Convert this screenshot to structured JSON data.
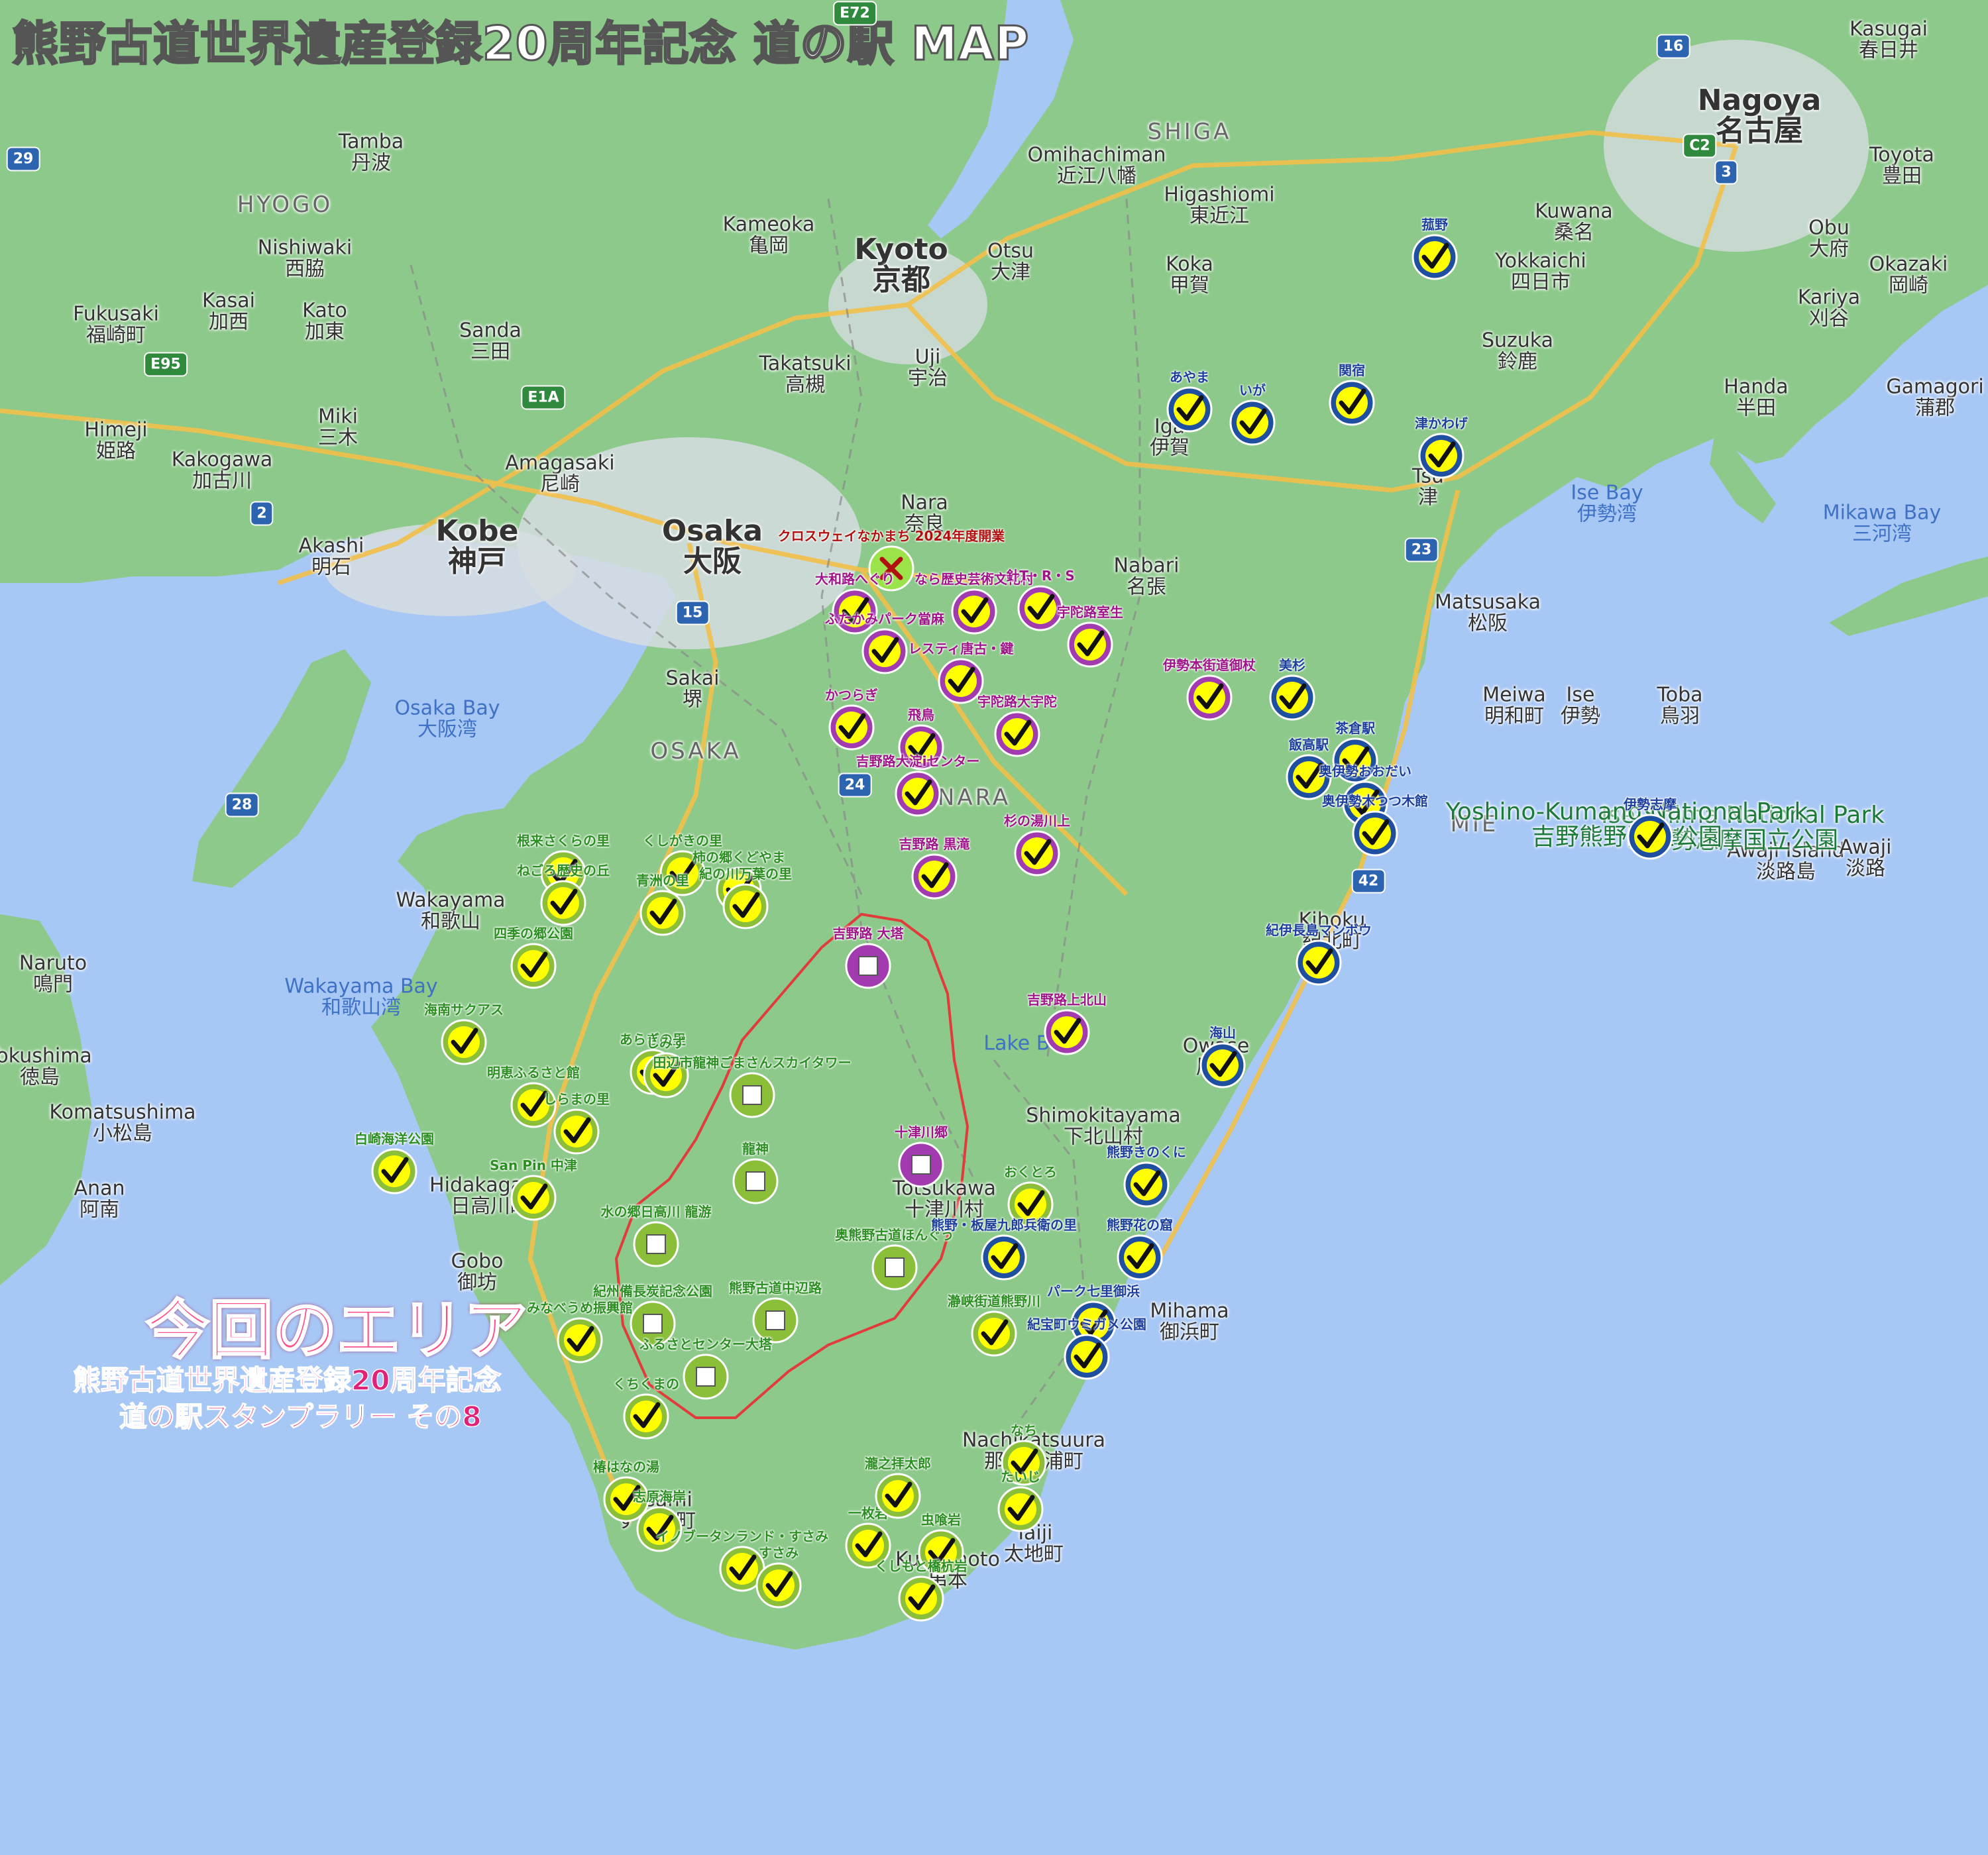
{
  "title": "熊野古道世界遺産登録20周年記念 道の駅 MAP",
  "area_title": "今回のエリア",
  "area_subtitle_1": "熊野古道世界遺産登録20周年記念",
  "area_subtitle_2": "道の駅スタンプラリー その8",
  "colors": {
    "land": "#8cc98a",
    "water": "#a7c7f5",
    "route": "#f2c04a",
    "area_outline": "#e23b3b",
    "marker_green": "#8bbf3a",
    "marker_purple": "#a23bb0",
    "marker_blue": "#1e4fa0",
    "check": "#ffff00"
  },
  "places": [
    {
      "name": "Nagoya 名古屋",
      "cls": "city"
    },
    {
      "name": "Kyoto 京都",
      "cls": "city"
    },
    {
      "name": "Osaka 大阪",
      "cls": "city"
    },
    {
      "name": "Kobe 神戸",
      "cls": "city"
    },
    {
      "name": "Himeji 姫路",
      "cls": "town"
    },
    {
      "name": "Wakayama 和歌山",
      "cls": "town"
    },
    {
      "name": "Nara 奈良",
      "cls": "town"
    },
    {
      "name": "Sakai 堺",
      "cls": "town"
    },
    {
      "name": "Otsu 大津",
      "cls": "town"
    },
    {
      "name": "Takatsuki 高槻",
      "cls": "town"
    },
    {
      "name": "Amagasaki 尼崎",
      "cls": "town"
    },
    {
      "name": "Akashi 明石",
      "cls": "town"
    },
    {
      "name": "Kameoka 亀岡",
      "cls": "town"
    },
    {
      "name": "Uji 宇治",
      "cls": "town"
    },
    {
      "name": "Kakogawa 加古川",
      "cls": "town"
    },
    {
      "name": "Miki 三木",
      "cls": "town"
    },
    {
      "name": "Sanda 三田",
      "cls": "town"
    },
    {
      "name": "Kato 加東",
      "cls": "town"
    },
    {
      "name": "Nishiwaki 西脇",
      "cls": "town"
    },
    {
      "name": "Tamba 丹波",
      "cls": "town"
    },
    {
      "name": "Kasai 加西",
      "cls": "town"
    },
    {
      "name": "Fukusaki 福崎町",
      "cls": "town"
    },
    {
      "name": "Omihachiman 近江八幡",
      "cls": "town"
    },
    {
      "name": "Higashiomi 東近江",
      "cls": "town"
    },
    {
      "name": "Koka 甲賀",
      "cls": "town"
    },
    {
      "name": "Iga 伊賀",
      "cls": "town"
    },
    {
      "name": "Nabari 名張",
      "cls": "town"
    },
    {
      "name": "Kuwana 桑名",
      "cls": "town"
    },
    {
      "name": "Yokkaichi 四日市",
      "cls": "town"
    },
    {
      "name": "Suzuka 鈴鹿",
      "cls": "town"
    },
    {
      "name": "Tsu 津",
      "cls": "town"
    },
    {
      "name": "Matsusaka 松阪",
      "cls": "town"
    },
    {
      "name": "Meiwa 明和町",
      "cls": "town"
    },
    {
      "name": "Ise 伊勢",
      "cls": "town"
    },
    {
      "name": "Toba 鳥羽",
      "cls": "town"
    },
    {
      "name": "Toyota 豊田",
      "cls": "town"
    },
    {
      "name": "Okazaki 岡崎",
      "cls": "town"
    },
    {
      "name": "Kariya 刈谷",
      "cls": "town"
    },
    {
      "name": "Handa 半田",
      "cls": "town"
    },
    {
      "name": "Obu 大府",
      "cls": "town"
    },
    {
      "name": "Kasugai 春日井",
      "cls": "town"
    },
    {
      "name": "Gamagori 蒲郡",
      "cls": "town"
    },
    {
      "name": "Naruto 鳴門",
      "cls": "town"
    },
    {
      "name": "Tokushima 徳島",
      "cls": "town"
    },
    {
      "name": "Komatsushima 小松島",
      "cls": "town"
    },
    {
      "name": "Anan 阿南",
      "cls": "town"
    },
    {
      "name": "Hidakagawa 日高川町",
      "cls": "town"
    },
    {
      "name": "Gobo 御坊",
      "cls": "town"
    },
    {
      "name": "Susami すさみ町",
      "cls": "town"
    },
    {
      "name": "Kushimoto 串本",
      "cls": "town"
    },
    {
      "name": "Nachikatsuura 那智勝浦町",
      "cls": "town"
    },
    {
      "name": "Taiji 太地町",
      "cls": "town"
    },
    {
      "name": "Totsukawa 十津川村",
      "cls": "town"
    },
    {
      "name": "Shimokitayama 下北山村",
      "cls": "town"
    },
    {
      "name": "Owase 尾鷲",
      "cls": "town"
    },
    {
      "name": "Kihoku 紀北町",
      "cls": "town"
    },
    {
      "name": "Mihama 御浜町",
      "cls": "town"
    },
    {
      "name": "HYOGO",
      "cls": "region"
    },
    {
      "name": "SHIGA",
      "cls": "region"
    },
    {
      "name": "OSAKA",
      "cls": "region"
    },
    {
      "name": "NARA",
      "cls": "region"
    },
    {
      "name": "MIE",
      "cls": "region"
    },
    {
      "name": "Osaka Bay 大阪湾",
      "cls": "water"
    },
    {
      "name": "Wakayama Bay 和歌山湾",
      "cls": "water"
    },
    {
      "name": "Ise Bay 伊勢湾",
      "cls": "water"
    },
    {
      "name": "Mikawa Bay 三河湾",
      "cls": "water"
    },
    {
      "name": "Awaji Island 淡路島",
      "cls": "town"
    },
    {
      "name": "Awaji 淡路",
      "cls": "town"
    },
    {
      "name": "Ise-Shima National Park 伊勢志摩国立公園",
      "cls": "park"
    },
    {
      "name": "Yoshino-Kumano National Park 吉野熊野国立公園",
      "cls": "park"
    },
    {
      "name": "Lake Biwa",
      "cls": "water"
    }
  ],
  "markers": [
    {
      "label": "クロスウェイなかまち 2024年度開業",
      "type": "x"
    },
    {
      "label": "なら歴史芸術文化村",
      "type": "p"
    },
    {
      "label": "針T・R・S",
      "type": "p"
    },
    {
      "label": "大和路へぐり",
      "type": "p"
    },
    {
      "label": "宇陀路室生",
      "type": "p"
    },
    {
      "label": "ふたかみパーク當麻",
      "type": "p"
    },
    {
      "label": "レスティ唐古・鍵",
      "type": "p"
    },
    {
      "label": "かつらぎ",
      "type": "p"
    },
    {
      "label": "飛鳥",
      "type": "p"
    },
    {
      "label": "宇陀路大宇陀",
      "type": "p"
    },
    {
      "label": "吉野路大淀iセンター",
      "type": "p"
    },
    {
      "label": "吉野路 黒滝",
      "type": "p"
    },
    {
      "label": "杉の湯川上",
      "type": "p"
    },
    {
      "label": "吉野路上北山",
      "type": "p"
    },
    {
      "label": "伊勢本街道御杖",
      "type": "p"
    },
    {
      "label": "根来さくらの里",
      "type": "g"
    },
    {
      "label": "くしがきの里",
      "type": "g"
    },
    {
      "label": "柿の郷くどやま",
      "type": "g"
    },
    {
      "label": "ねごろ歴史の丘",
      "type": "g"
    },
    {
      "label": "青洲の里",
      "type": "g"
    },
    {
      "label": "紀の川万葉の里",
      "type": "g"
    },
    {
      "label": "四季の郷公園",
      "type": "g"
    },
    {
      "label": "海南サクアス",
      "type": "g"
    },
    {
      "label": "あらぎの里",
      "type": "g"
    },
    {
      "label": "しみず",
      "type": "g"
    },
    {
      "label": "明恵ふるさと館",
      "type": "g"
    },
    {
      "label": "しらまの里",
      "type": "g"
    },
    {
      "label": "白崎海洋公園",
      "type": "g"
    },
    {
      "label": "San Pin 中津",
      "type": "g"
    },
    {
      "label": "みなべうめ振興館",
      "type": "g"
    },
    {
      "label": "くちくまの",
      "type": "g"
    },
    {
      "label": "椿はなの湯",
      "type": "g"
    },
    {
      "label": "志原海岸",
      "type": "g"
    },
    {
      "label": "イノブータンランド・すさみ",
      "type": "g"
    },
    {
      "label": "すさみ",
      "type": "g"
    },
    {
      "label": "一枚岩",
      "type": "g"
    },
    {
      "label": "瀧之拝太郎",
      "type": "g"
    },
    {
      "label": "虫喰岩",
      "type": "g"
    },
    {
      "label": "くしもと橋杭岩",
      "type": "g"
    },
    {
      "label": "なち",
      "type": "g"
    },
    {
      "label": "たいじ",
      "type": "g"
    },
    {
      "label": "おくとろ",
      "type": "g"
    },
    {
      "label": "瀞峡街道熊野川",
      "type": "g"
    },
    {
      "label": "田辺市龍神ごまさんスカイタワー",
      "type": "gs"
    },
    {
      "label": "龍神",
      "type": "gs"
    },
    {
      "label": "水の郷日高川 龍游",
      "type": "gs"
    },
    {
      "label": "紀州備長炭記念公園",
      "type": "gs"
    },
    {
      "label": "熊野古道中辺路",
      "type": "gs"
    },
    {
      "label": "ふるさとセンター大塔",
      "type": "gs"
    },
    {
      "label": "奥熊野古道ほんぐう",
      "type": "gs"
    },
    {
      "label": "吉野路 大塔",
      "type": "ps"
    },
    {
      "label": "十津川郷",
      "type": "ps"
    },
    {
      "label": "菰野",
      "type": "b"
    },
    {
      "label": "あやま",
      "type": "b"
    },
    {
      "label": "いが",
      "type": "b"
    },
    {
      "label": "関宿",
      "type": "b"
    },
    {
      "label": "津かわげ",
      "type": "b"
    },
    {
      "label": "美杉",
      "type": "b"
    },
    {
      "label": "茶倉駅",
      "type": "b"
    },
    {
      "label": "飯高駅",
      "type": "b"
    },
    {
      "label": "奥伊勢おおだい",
      "type": "b"
    },
    {
      "label": "奥伊勢木つつ木館",
      "type": "b"
    },
    {
      "label": "伊勢志摩",
      "type": "b"
    },
    {
      "label": "紀伊長島マンボウ",
      "type": "b"
    },
    {
      "label": "海山",
      "type": "b"
    },
    {
      "label": "熊野きのくに",
      "type": "b"
    },
    {
      "label": "熊野・板屋九郎兵衛の里",
      "type": "b"
    },
    {
      "label": "熊野花の窟",
      "type": "b"
    },
    {
      "label": "パーク七里御浜",
      "type": "b"
    },
    {
      "label": "紀宝町ウミガメ公園",
      "type": "b"
    }
  ],
  "shields": [
    "29",
    "E95",
    "E1A",
    "2",
    "15",
    "24",
    "28",
    "23",
    "42",
    "3",
    "16",
    "C2",
    "E72"
  ]
}
